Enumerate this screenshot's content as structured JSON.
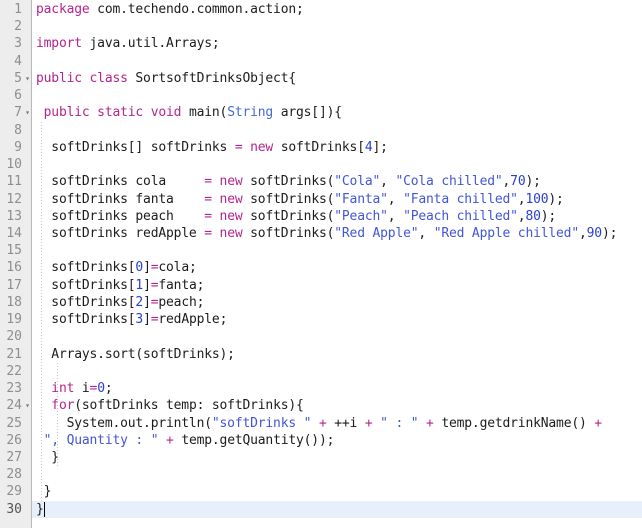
{
  "editor": {
    "language": "Java",
    "total_lines": 30,
    "current_line": 30,
    "colors": {
      "background": "#ffffff",
      "gutter_background": "#ededed",
      "gutter_text": "#8e8e8e",
      "keyword": "#b5248f",
      "string": "#4356d6",
      "number": "#2a3fd0",
      "type": "#4669d6",
      "operator": "#b5248f",
      "plain_text": "#1c1c1c",
      "current_line_highlight": "#e7effc"
    },
    "fold_markers": [
      5,
      7,
      24
    ],
    "line_numbers": [
      "1",
      "2",
      "3",
      "4",
      "5",
      "6",
      "7",
      "8",
      "9",
      "10",
      "11",
      "12",
      "13",
      "14",
      "15",
      "16",
      "17",
      "18",
      "19",
      "20",
      "21",
      "22",
      "23",
      "24",
      "25",
      "26",
      "27",
      "28",
      "29",
      "30"
    ],
    "lines": [
      {
        "n": 1,
        "tokens": [
          {
            "t": "package",
            "c": "kw"
          },
          {
            "t": " com.techendo.common.action;",
            "c": "pl"
          }
        ]
      },
      {
        "n": 2,
        "tokens": [
          {
            "t": "",
            "c": "pl"
          }
        ]
      },
      {
        "n": 3,
        "tokens": [
          {
            "t": "import",
            "c": "kw"
          },
          {
            "t": " java.util.Arrays;",
            "c": "pl"
          }
        ]
      },
      {
        "n": 4,
        "tokens": [
          {
            "t": "",
            "c": "pl"
          }
        ]
      },
      {
        "n": 5,
        "tokens": [
          {
            "t": "public class",
            "c": "kw"
          },
          {
            "t": " SortsoftDrinksObject{",
            "c": "pl"
          }
        ]
      },
      {
        "n": 6,
        "tokens": [
          {
            "t": "",
            "c": "pl"
          }
        ]
      },
      {
        "n": 7,
        "tokens": [
          {
            "t": " ",
            "c": "pl"
          },
          {
            "t": "public static void",
            "c": "kw"
          },
          {
            "t": " main(",
            "c": "pl"
          },
          {
            "t": "String",
            "c": "typ"
          },
          {
            "t": " args[]){",
            "c": "pl"
          }
        ]
      },
      {
        "n": 8,
        "tokens": [
          {
            "t": "",
            "c": "pl"
          }
        ]
      },
      {
        "n": 9,
        "tokens": [
          {
            "t": "  softDrinks[] softDrinks ",
            "c": "pl"
          },
          {
            "t": "=",
            "c": "op"
          },
          {
            "t": " ",
            "c": "pl"
          },
          {
            "t": "new",
            "c": "kw"
          },
          {
            "t": " softDrinks[",
            "c": "pl"
          },
          {
            "t": "4",
            "c": "num"
          },
          {
            "t": "];",
            "c": "pl"
          }
        ]
      },
      {
        "n": 10,
        "tokens": [
          {
            "t": "",
            "c": "pl"
          }
        ]
      },
      {
        "n": 11,
        "tokens": [
          {
            "t": "  softDrinks cola     ",
            "c": "pl"
          },
          {
            "t": "=",
            "c": "op"
          },
          {
            "t": " ",
            "c": "pl"
          },
          {
            "t": "new",
            "c": "kw"
          },
          {
            "t": " softDrinks(",
            "c": "pl"
          },
          {
            "t": "\"Cola\"",
            "c": "str"
          },
          {
            "t": ", ",
            "c": "pl"
          },
          {
            "t": "\"Cola chilled\"",
            "c": "str"
          },
          {
            "t": ",",
            "c": "pl"
          },
          {
            "t": "70",
            "c": "num"
          },
          {
            "t": ");",
            "c": "pl"
          }
        ]
      },
      {
        "n": 12,
        "tokens": [
          {
            "t": "  softDrinks fanta    ",
            "c": "pl"
          },
          {
            "t": "=",
            "c": "op"
          },
          {
            "t": " ",
            "c": "pl"
          },
          {
            "t": "new",
            "c": "kw"
          },
          {
            "t": " softDrinks(",
            "c": "pl"
          },
          {
            "t": "\"Fanta\"",
            "c": "str"
          },
          {
            "t": ", ",
            "c": "pl"
          },
          {
            "t": "\"Fanta chilled\"",
            "c": "str"
          },
          {
            "t": ",",
            "c": "pl"
          },
          {
            "t": "100",
            "c": "num"
          },
          {
            "t": ");",
            "c": "pl"
          }
        ]
      },
      {
        "n": 13,
        "tokens": [
          {
            "t": "  softDrinks peach    ",
            "c": "pl"
          },
          {
            "t": "=",
            "c": "op"
          },
          {
            "t": " ",
            "c": "pl"
          },
          {
            "t": "new",
            "c": "kw"
          },
          {
            "t": " softDrinks(",
            "c": "pl"
          },
          {
            "t": "\"Peach\"",
            "c": "str"
          },
          {
            "t": ", ",
            "c": "pl"
          },
          {
            "t": "\"Peach chilled\"",
            "c": "str"
          },
          {
            "t": ",",
            "c": "pl"
          },
          {
            "t": "80",
            "c": "num"
          },
          {
            "t": ");",
            "c": "pl"
          }
        ]
      },
      {
        "n": 14,
        "tokens": [
          {
            "t": "  softDrinks redApple ",
            "c": "pl"
          },
          {
            "t": "=",
            "c": "op"
          },
          {
            "t": " ",
            "c": "pl"
          },
          {
            "t": "new",
            "c": "kw"
          },
          {
            "t": " softDrinks(",
            "c": "pl"
          },
          {
            "t": "\"Red Apple\"",
            "c": "str"
          },
          {
            "t": ", ",
            "c": "pl"
          },
          {
            "t": "\"Red Apple chilled\"",
            "c": "str"
          },
          {
            "t": ",",
            "c": "pl"
          },
          {
            "t": "90",
            "c": "num"
          },
          {
            "t": ");",
            "c": "pl"
          }
        ]
      },
      {
        "n": 15,
        "tokens": [
          {
            "t": "",
            "c": "pl"
          }
        ]
      },
      {
        "n": 16,
        "tokens": [
          {
            "t": "  softDrinks[",
            "c": "pl"
          },
          {
            "t": "0",
            "c": "num"
          },
          {
            "t": "]",
            "c": "pl"
          },
          {
            "t": "=",
            "c": "op"
          },
          {
            "t": "cola;",
            "c": "pl"
          }
        ]
      },
      {
        "n": 17,
        "tokens": [
          {
            "t": "  softDrinks[",
            "c": "pl"
          },
          {
            "t": "1",
            "c": "num"
          },
          {
            "t": "]",
            "c": "pl"
          },
          {
            "t": "=",
            "c": "op"
          },
          {
            "t": "fanta;",
            "c": "pl"
          }
        ]
      },
      {
        "n": 18,
        "tokens": [
          {
            "t": "  softDrinks[",
            "c": "pl"
          },
          {
            "t": "2",
            "c": "num"
          },
          {
            "t": "]",
            "c": "pl"
          },
          {
            "t": "=",
            "c": "op"
          },
          {
            "t": "peach;",
            "c": "pl"
          }
        ]
      },
      {
        "n": 19,
        "tokens": [
          {
            "t": "  softDrinks[",
            "c": "pl"
          },
          {
            "t": "3",
            "c": "num"
          },
          {
            "t": "]",
            "c": "pl"
          },
          {
            "t": "=",
            "c": "op"
          },
          {
            "t": "redApple;",
            "c": "pl"
          }
        ]
      },
      {
        "n": 20,
        "tokens": [
          {
            "t": "",
            "c": "pl"
          }
        ]
      },
      {
        "n": 21,
        "tokens": [
          {
            "t": "  Arrays.sort(softDrinks);",
            "c": "pl"
          }
        ]
      },
      {
        "n": 22,
        "tokens": [
          {
            "t": "",
            "c": "pl"
          }
        ]
      },
      {
        "n": 23,
        "tokens": [
          {
            "t": "  ",
            "c": "pl"
          },
          {
            "t": "int",
            "c": "kw"
          },
          {
            "t": " i",
            "c": "pl"
          },
          {
            "t": "=",
            "c": "op"
          },
          {
            "t": "0",
            "c": "num"
          },
          {
            "t": ";",
            "c": "pl"
          }
        ]
      },
      {
        "n": 24,
        "tokens": [
          {
            "t": "  ",
            "c": "pl"
          },
          {
            "t": "for",
            "c": "kw"
          },
          {
            "t": "(softDrinks temp: softDrinks){",
            "c": "pl"
          }
        ]
      },
      {
        "n": 25,
        "tokens": [
          {
            "t": "    System.out.println(",
            "c": "pl"
          },
          {
            "t": "\"softDrinks \"",
            "c": "str"
          },
          {
            "t": " + ",
            "c": "op"
          },
          {
            "t": "++i",
            "c": "pl"
          },
          {
            "t": " + ",
            "c": "op"
          },
          {
            "t": "\" : \"",
            "c": "str"
          },
          {
            "t": " + ",
            "c": "op"
          },
          {
            "t": "temp.getdrinkName()",
            "c": "pl"
          },
          {
            "t": " +",
            "c": "op"
          }
        ]
      },
      {
        "n": 26,
        "tokens": [
          {
            "t": " ",
            "c": "pl"
          },
          {
            "t": "\", Quantity : \"",
            "c": "str"
          },
          {
            "t": " + ",
            "c": "op"
          },
          {
            "t": "temp.getQuantity());",
            "c": "pl"
          }
        ]
      },
      {
        "n": 27,
        "tokens": [
          {
            "t": "  }",
            "c": "pl"
          }
        ]
      },
      {
        "n": 28,
        "tokens": [
          {
            "t": "",
            "c": "pl"
          }
        ]
      },
      {
        "n": 29,
        "tokens": [
          {
            "t": " }",
            "c": "pl"
          }
        ]
      },
      {
        "n": 30,
        "tokens": [
          {
            "t": "}",
            "c": "pl"
          }
        ]
      }
    ],
    "indent_guides": [
      {
        "x": 9,
        "from_line": 8,
        "to_line": 29
      },
      {
        "x": 25,
        "from_line": 22,
        "to_line": 27
      }
    ]
  }
}
